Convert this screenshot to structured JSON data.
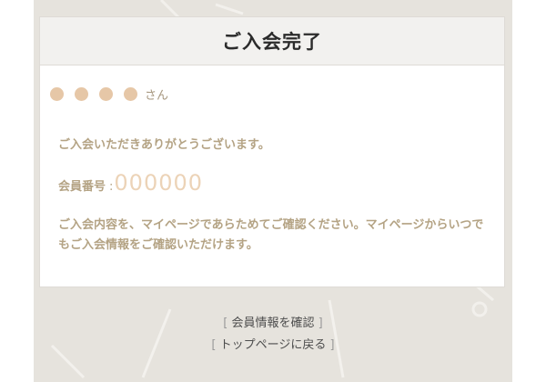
{
  "card": {
    "title": "ご入会完了",
    "name_placeholder_dots": 4,
    "name_suffix": "さん",
    "thanks_message": "ご入会いただきありがとうございます。",
    "member_number_label": "会員番号",
    "member_number_colon": ":",
    "member_number_value": "000000",
    "confirm_message": "ご入会内容を、マイページであらためてご確認ください。マイページからいつでもご入会情報をご確認いただけます。"
  },
  "links": {
    "bracket_open": "[",
    "bracket_close": "]",
    "member_info_label": "会員情報を確認",
    "top_page_label": "トップページに戻る"
  },
  "colors": {
    "background": "#e6e3dd",
    "card_header": "#f2f1ef",
    "accent_text": "#b4a384",
    "dot_color": "#e6c7a7",
    "member_number_color": "#ecd3b7"
  }
}
